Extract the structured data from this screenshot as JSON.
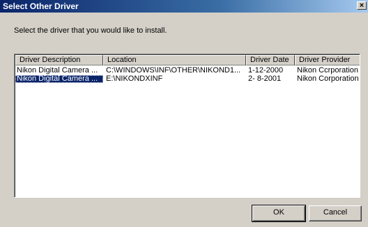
{
  "window": {
    "title": "Select Other Driver",
    "close_glyph": "×"
  },
  "instruction": "Select the driver that you would like to install.",
  "list": {
    "columns": [
      "Driver Description",
      "Location",
      "Driver Date",
      "Driver Provider"
    ],
    "rows": [
      [
        "Nikon Digital Camera ...",
        "C:\\WINDOWS\\INF\\OTHER\\NIKOND1...",
        "1-12-2000",
        "Nikon Ccrporation"
      ],
      [
        "Nikon Digital Camera ...",
        "E:\\NIKONDXINF",
        "2- 8-2001",
        "Nikon Corporation"
      ]
    ],
    "selected_row": 1
  },
  "buttons": {
    "ok": "OK",
    "cancel": "Cancel"
  },
  "colors": {
    "title_bar": "#0a246a",
    "selection": "#0a246a",
    "face": "#d4d0c8"
  }
}
